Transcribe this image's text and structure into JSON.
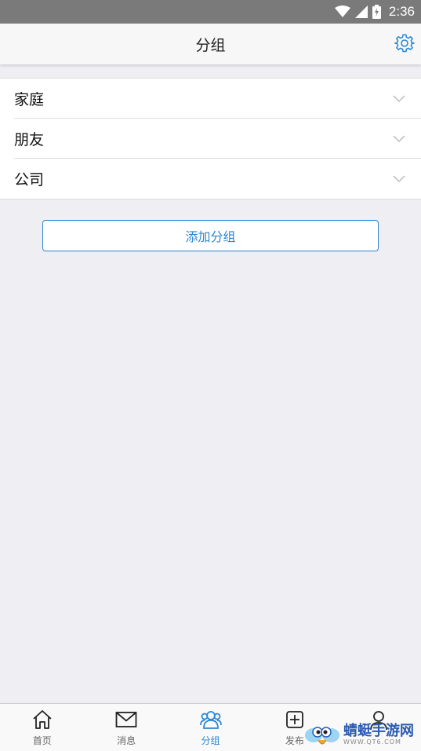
{
  "status_bar": {
    "time": "2:36"
  },
  "app_bar": {
    "title": "分组"
  },
  "groups": [
    {
      "label": "家庭"
    },
    {
      "label": "朋友"
    },
    {
      "label": "公司"
    }
  ],
  "add_group_button": "添加分组",
  "bottom_nav": {
    "items": [
      {
        "label": "首页",
        "icon": "home-icon"
      },
      {
        "label": "消息",
        "icon": "mail-icon"
      },
      {
        "label": "分组",
        "icon": "group-icon",
        "active": true
      },
      {
        "label": "发布",
        "icon": "plus-square-icon"
      },
      {
        "label": "",
        "icon": "user-icon"
      }
    ]
  },
  "watermark": {
    "title": "蜻蜓手游网",
    "url": "WWW.QT6.COM"
  },
  "colors": {
    "accent": "#2a86d6",
    "status_bar": "#7a7a7a",
    "background": "#eeeef3"
  }
}
